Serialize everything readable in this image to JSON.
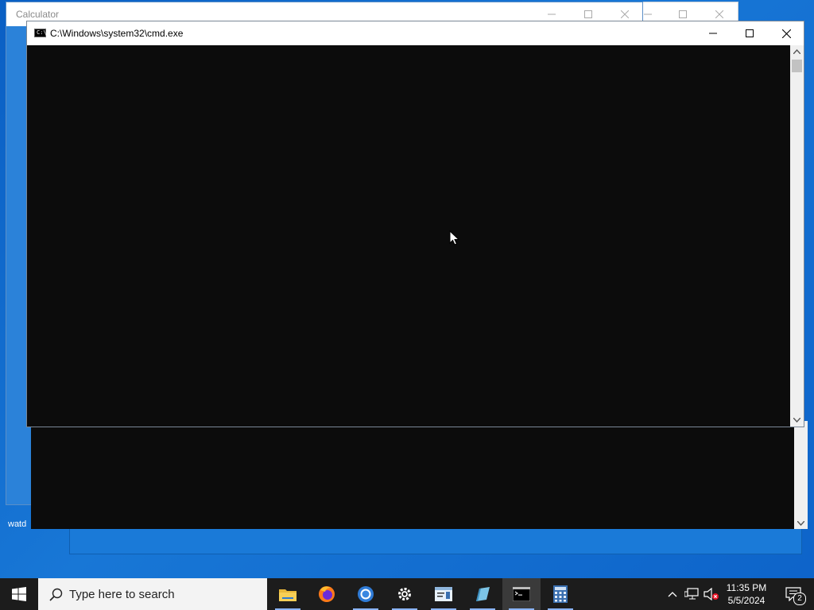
{
  "windows": {
    "calculator": {
      "title": "Calculator"
    },
    "cmd": {
      "title": "C:\\Windows\\system32\\cmd.exe"
    }
  },
  "desktop": {
    "partial_label": "watd"
  },
  "taskbar": {
    "search_placeholder": "Type here to search",
    "apps": [
      "file-explorer",
      "firefox",
      "chrome",
      "settings",
      "notepad",
      "pencil",
      "terminal",
      "calculator"
    ],
    "clock": {
      "time": "11:35 PM",
      "date": "5/5/2024"
    },
    "notifications_count": "2"
  },
  "colors": {
    "accent": "#0078d7",
    "console_bg": "#0c0c0c",
    "taskbar_bg": "#1c1c1c"
  }
}
